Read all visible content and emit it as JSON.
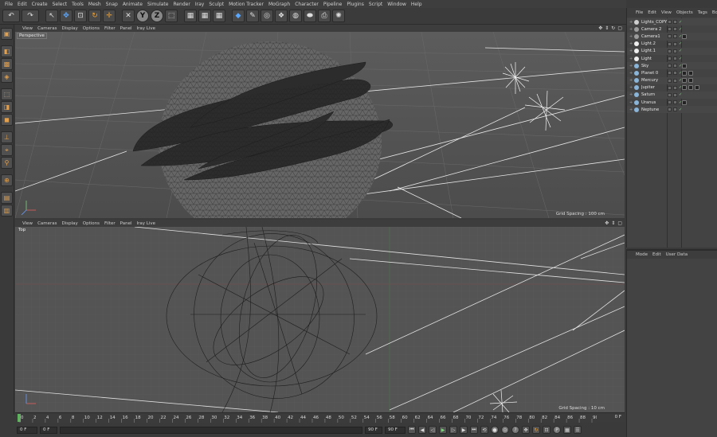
{
  "menubar": [
    "File",
    "Edit",
    "Create",
    "Select",
    "Tools",
    "Mesh",
    "Snap",
    "Animate",
    "Simulate",
    "Render",
    "Iray",
    "Sculpt",
    "Motion Tracker",
    "MoGraph",
    "Character",
    "Pipeline",
    "Plugins",
    "Script",
    "Window",
    "Help"
  ],
  "viewport_menu": [
    "View",
    "Cameras",
    "Display",
    "Options",
    "Filter",
    "Panel",
    "Iray Live"
  ],
  "viewport_top_menu": [
    "View",
    "Cameras",
    "Display",
    "Options",
    "Filter",
    "Panel",
    "Iray Live"
  ],
  "perspective_label": "Perspective",
  "top_label": "Top",
  "grid_spacing_persp": "Grid Spacing : 100 cm",
  "grid_spacing_top": "Grid Spacing : 10 cm",
  "object_manager": {
    "menu": [
      "File",
      "Edit",
      "View",
      "Objects",
      "Tags",
      "Book"
    ],
    "objects": [
      {
        "name": "Lights_COPY",
        "icon_color": "#cfcfcf",
        "tags": 0
      },
      {
        "name": "Camera 2",
        "icon_color": "#9c9c9c",
        "tags": 0
      },
      {
        "name": "Camera1",
        "icon_color": "#9c9c9c",
        "tags": 1
      },
      {
        "name": "Light.2",
        "icon_color": "#eeeeee",
        "tags": 0
      },
      {
        "name": "Light.1",
        "icon_color": "#eeeeee",
        "tags": 0
      },
      {
        "name": "Light",
        "icon_color": "#eeeeee",
        "tags": 0
      },
      {
        "name": "Sky",
        "icon_color": "#8ab4d8",
        "tags": 1
      },
      {
        "name": "Planet 0",
        "icon_color": "#8ab4d8",
        "tags": 2
      },
      {
        "name": "Mercury",
        "icon_color": "#8ab4d8",
        "tags": 2
      },
      {
        "name": "Jupiter",
        "icon_color": "#8ab4d8",
        "tags": 3
      },
      {
        "name": "Saturn",
        "icon_color": "#8ab4d8",
        "tags": 0
      },
      {
        "name": "Uranus",
        "icon_color": "#8ab4d8",
        "tags": 1
      },
      {
        "name": "Neptune",
        "icon_color": "#8ab4d8",
        "tags": 0
      }
    ]
  },
  "attribute_manager": {
    "menu": [
      "Mode",
      "Edit",
      "User Data"
    ]
  },
  "timeline": {
    "ticks": [
      0,
      2,
      4,
      6,
      8,
      10,
      12,
      14,
      16,
      18,
      20,
      22,
      24,
      26,
      28,
      30,
      32,
      34,
      36,
      38,
      40,
      42,
      44,
      46,
      48,
      50,
      52,
      54,
      56,
      58,
      60,
      62,
      64,
      66,
      68,
      70,
      72,
      74,
      76,
      78,
      80,
      82,
      84,
      86,
      88,
      90
    ],
    "max": 90,
    "current_frame": "0 F"
  },
  "transport": {
    "start": "0 F",
    "start2": "0 F",
    "end": "90 F",
    "end2": "90 F"
  },
  "colors": {
    "viewport": "#555555",
    "panel": "#434343",
    "accent": "#f0a030"
  }
}
